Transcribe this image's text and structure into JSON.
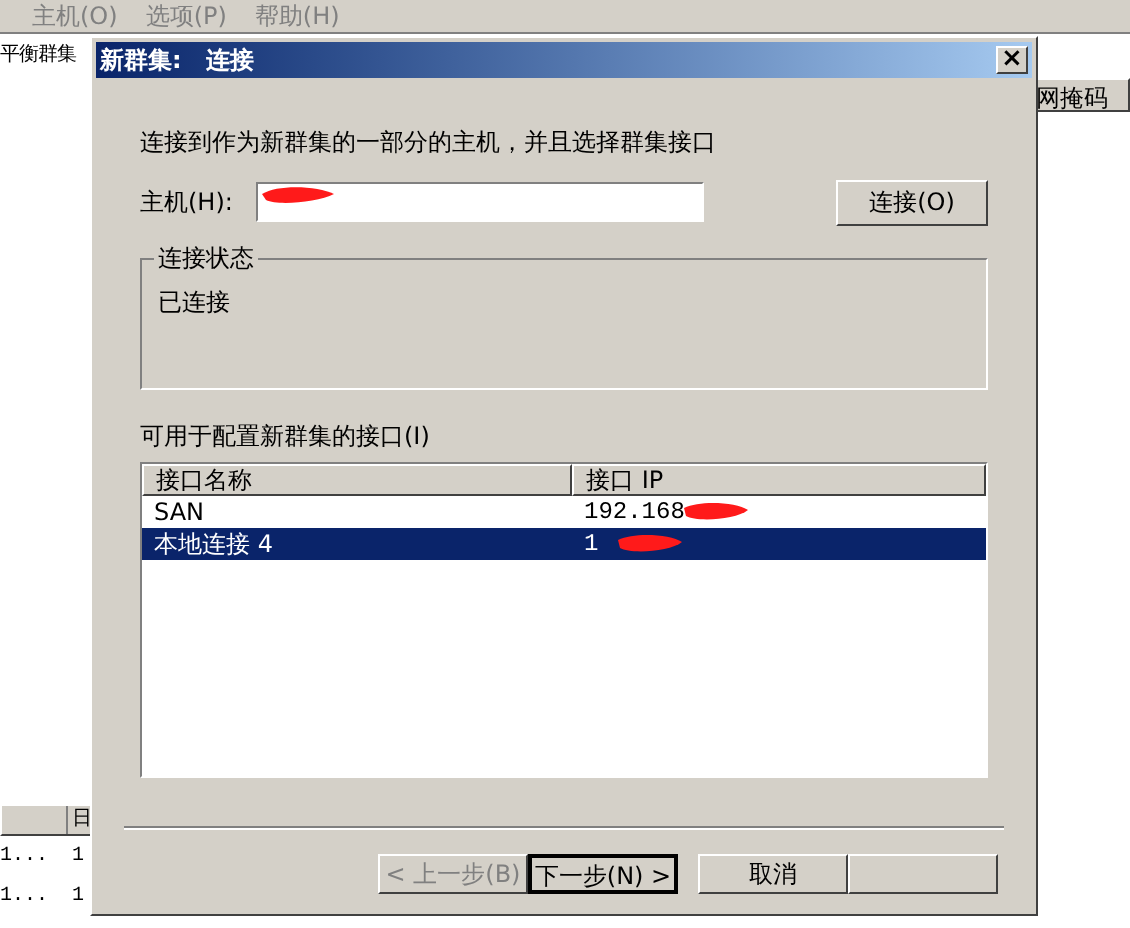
{
  "background": {
    "menu": [
      "主机(O)",
      "选项(P)",
      "帮助(H)"
    ],
    "left_pane_text": "平衡群集",
    "right_header": "网掩码",
    "bottom_list": {
      "columns": [
        null,
        "日"
      ],
      "rows": [
        [
          "1...",
          "1"
        ],
        [
          "1...",
          "1"
        ]
      ]
    }
  },
  "dialog": {
    "title": "新群集:　连接",
    "close": "×",
    "instruction": "连接到作为新群集的一部分的主机，并且选择群集接口",
    "host": {
      "label": "主机(H):",
      "redacted": true
    },
    "connect_button": "连接(O)",
    "status_group": {
      "title": "连接状态",
      "text": "已连接"
    },
    "interfaces_label": "可用于配置新群集的接口(I)",
    "interfaces": {
      "columns": [
        "接口名称",
        "接口 IP"
      ],
      "rows": [
        {
          "name": "SAN",
          "ip": "192.168",
          "selected": false
        },
        {
          "name": "本地连接 4",
          "ip": "1",
          "selected": true
        }
      ]
    },
    "buttons": [
      {
        "label": "< 上一步(B)",
        "disabled": true,
        "default": false
      },
      {
        "label": "下一步(N) >",
        "disabled": false,
        "default": true
      },
      {
        "label": "取消",
        "disabled": false,
        "default": false
      }
    ]
  }
}
